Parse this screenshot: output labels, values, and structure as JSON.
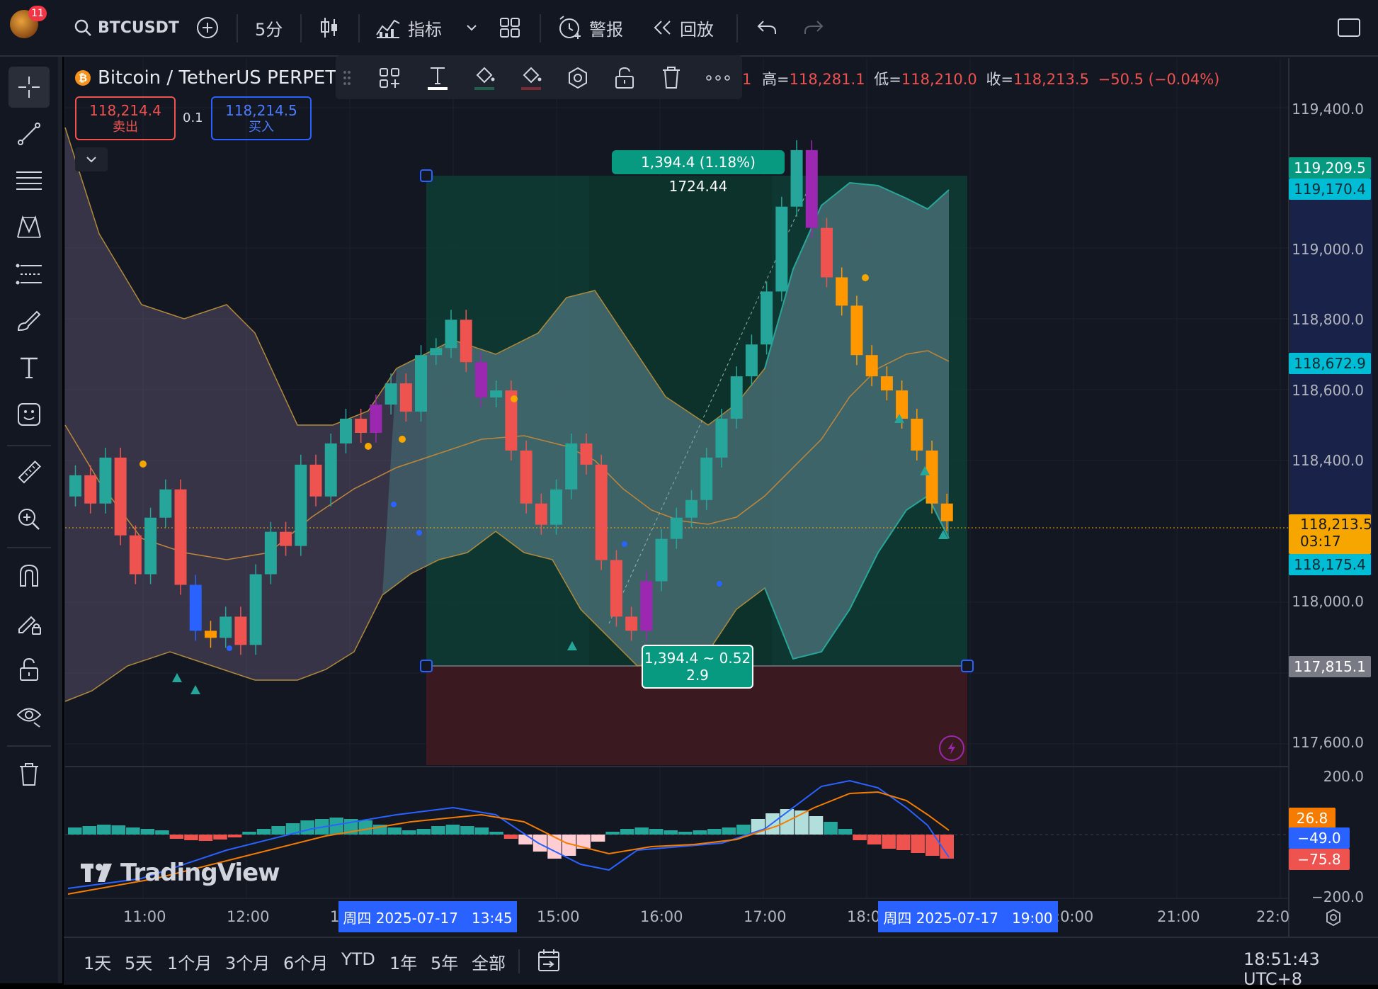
{
  "topbar": {
    "notification_count": "11",
    "symbol": "BTCUSDT",
    "interval": "5分",
    "indicators_label": "指标",
    "alerts_label": "警报",
    "replay_label": "回放"
  },
  "legend": {
    "symbol_title": "Bitcoin / TetherUS PERPET",
    "ohlc_prefix": "1",
    "high_label": "高=",
    "high_value": "118,281.1",
    "low_label": "低=",
    "low_value": "118,210.0",
    "close_label": "收=",
    "close_value": "118,213.5",
    "change": "−50.5 (−0.04%)",
    "sell_price": "118,214.4",
    "sell_label": "卖出",
    "spread": "0.1",
    "buy_price": "118,214.5",
    "buy_label": "买入"
  },
  "price_axis": {
    "ticks": [
      "119,400.0",
      "119,000.0",
      "118,800.0",
      "118,600.0",
      "118,400.0",
      "118,000.0",
      "117,600.0"
    ],
    "tag_top": "119,209.5",
    "tag_upper_band": "119,170.4",
    "tag_mid": "118,672.9",
    "tag_current": "118,213.5",
    "tag_countdown": "03:17",
    "tag_lower_band": "118,175.4",
    "tag_stop": "117,815.1"
  },
  "macd_axis": {
    "ticks": [
      "200.0",
      "−200.0"
    ],
    "tag_signal": "26.8",
    "tag_macd": "−49.0",
    "tag_hist": "−75.8"
  },
  "position_tool": {
    "target_label": "1,394.4 (1.18%) 1724.44",
    "stop_label_line1": "1,394.4 ~ 0.52",
    "stop_label_line2": "2.9"
  },
  "time_axis": {
    "ticks": [
      "11:00",
      "12:00",
      "1",
      "15:00",
      "16:00",
      "17:00",
      "18:0",
      ":0:00",
      "21:00",
      "22:0"
    ],
    "range_start": "周四 2025-07-17   13:45",
    "range_end": "周四 2025-07-17   19:00"
  },
  "watermark": "TradingView",
  "bottombar": {
    "ranges": [
      "1天",
      "5天",
      "1个月",
      "3个月",
      "6个月",
      "YTD",
      "1年",
      "5年",
      "全部"
    ],
    "clock": "18:51:43 UTC+8"
  },
  "colors": {
    "up": "#26a69a",
    "down": "#ef5350",
    "band_fill": "#5b8a8a",
    "target_fill": "#0f3d33",
    "stop_fill": "#3b1a20",
    "accent_blue": "#2962ff",
    "current_price": "#f7a600"
  }
}
